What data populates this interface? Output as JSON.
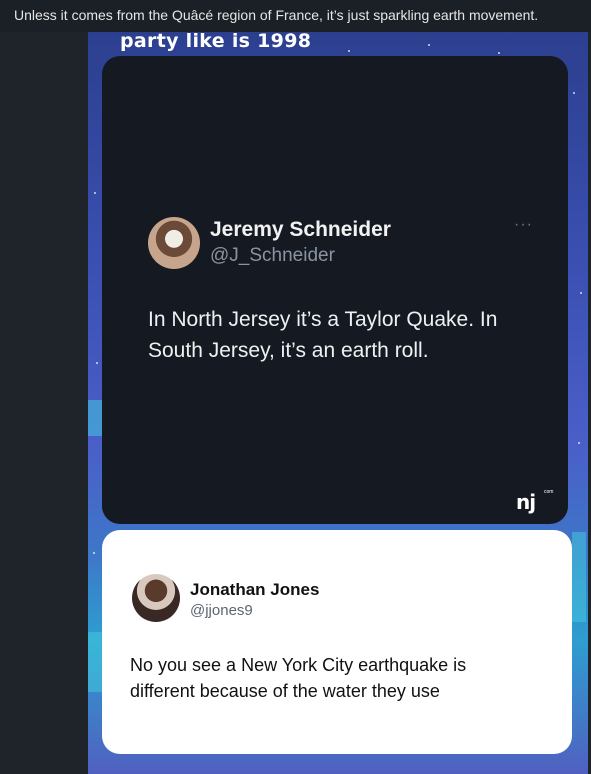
{
  "caption": "Unless it comes from the Quâcé region of France, it’s just sparkling earth movement.",
  "meme": {
    "background_text": "party like is 1998",
    "tweet1": {
      "name": "Jeremy Schneider",
      "handle": "@J_Schneider",
      "more": "···",
      "text": "In North Jersey it’s a Taylor Quake. In South Jersey, it’s an earth roll."
    },
    "watermark": {
      "logo": "nj",
      "small": "com"
    },
    "tweet2": {
      "name": "Jonathan Jones",
      "handle": "@jjones9",
      "text": "No you see a New York City earthquake is different because of the water they use"
    }
  },
  "colors": {
    "page_background": "#1b1f26",
    "dark_card": "#151a22",
    "white_card": "#ffffff"
  }
}
